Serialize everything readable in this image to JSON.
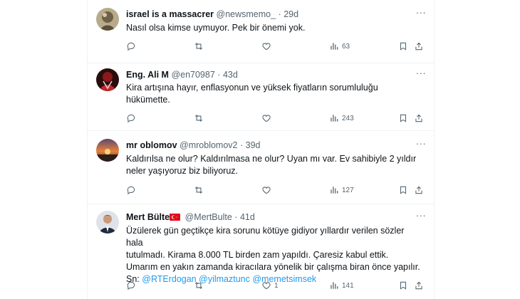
{
  "tweets": [
    {
      "name": "israel is a massacrer",
      "handle": "@newsmemo_",
      "age": "29d",
      "body_lines": [
        "Nasıl olsa kimse uymuyor. Pek bir önemi yok."
      ],
      "mentions": [],
      "views": "63",
      "flag": false
    },
    {
      "name": "Eng. Ali M",
      "handle": "@en70987",
      "age": "43d",
      "body_lines": [
        "Kira artışına hayır, enflasyonun ve yüksek fiyatların sorumluluğu",
        "hükümette."
      ],
      "mentions": [],
      "views": "243",
      "flag": false
    },
    {
      "name": "mr oblomov",
      "handle": "@mroblomov2",
      "age": "39d",
      "body_lines": [
        "Kaldırılsa ne olur? Kaldırılmasa ne olur? Uyan mı var. Ev sahibiyle 2 yıldır",
        "neler yaşıyoruz biz biliyoruz."
      ],
      "mentions": [],
      "views": "127",
      "flag": false
    },
    {
      "name": "Mert Bülte",
      "handle": "@MertBulte",
      "age": "41d",
      "body_lines": [
        "Üzülerek gün geçtikçe kira sorunu kötüye gidiyor yıllardır verilen sözler hala",
        "tutulmadı. Kirama 8.000 TL birden zam yapıldı. Çaresiz kabul ettik.",
        "Umarım en yakın zamanda kiracılara yönelik bir çalışma biran önce yapılır."
      ],
      "mentions_prefix": "Sn: ",
      "mentions": [
        "@RTErdogan",
        "@yilmaztunc",
        "@memetsimsek"
      ],
      "likes": "1",
      "views": "141",
      "flag": true
    }
  ],
  "dot_separator": "·",
  "more_label": "···",
  "icons": {
    "reply": "reply-icon",
    "repost": "repost-icon",
    "like": "heart-icon",
    "views": "views-icon",
    "bookmark": "bookmark-icon",
    "share": "share-icon",
    "more": "more-icon",
    "flag": "turkey-flag-icon"
  },
  "colors": {
    "text": "#0f1419",
    "muted": "#536471",
    "link": "#1d9bf0",
    "border": "#eff3f4",
    "flag_red": "#e30a17"
  }
}
